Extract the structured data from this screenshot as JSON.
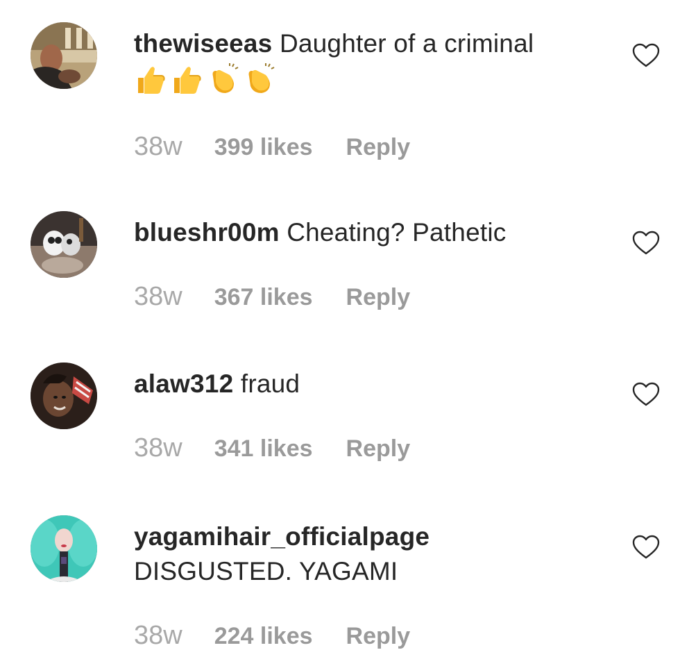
{
  "comments": [
    {
      "username": "thewiseeas",
      "text": "Daughter of a criminal",
      "emojis": [
        "thumbs-up",
        "thumbs-up",
        "clapping-hands",
        "clapping-hands"
      ],
      "age": "38w",
      "likes": "399 likes",
      "reply": "Reply"
    },
    {
      "username": "blueshr00m",
      "text": "Cheating? Pathetic",
      "age": "38w",
      "likes": "367 likes",
      "reply": "Reply"
    },
    {
      "username": "alaw312",
      "text": "fraud",
      "age": "38w",
      "likes": "341 likes",
      "reply": "Reply"
    },
    {
      "username": "yagamihair_officialpage",
      "text": "DISGUSTED. YAGAMI",
      "age": "38w",
      "likes": "224 likes",
      "reply": "Reply"
    }
  ],
  "icons": {
    "like": "heart-icon"
  },
  "colors": {
    "text": "#262626",
    "meta": "#8e8e8e",
    "background": "#ffffff"
  }
}
